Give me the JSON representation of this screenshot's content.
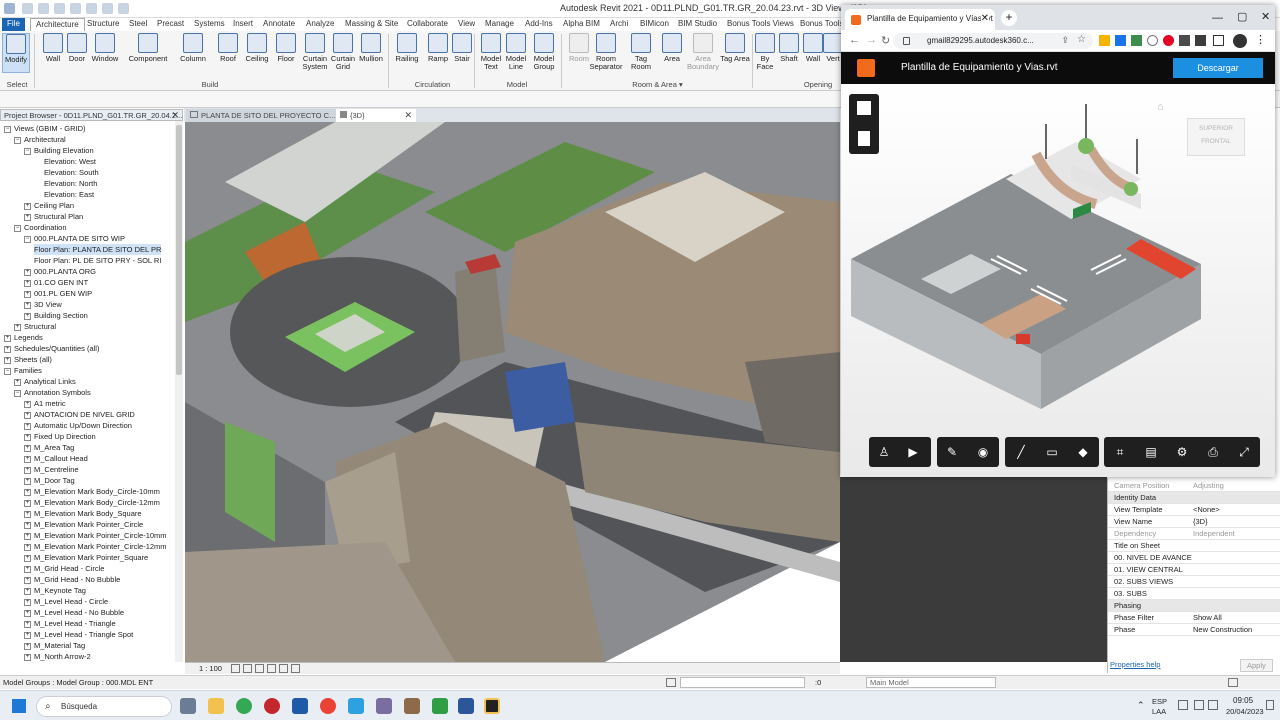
{
  "window": {
    "title": "Autodesk Revit 2021 - 0D11.PLND_G01.TR.GR_20.04.23.rvt - 3D View: {3D}"
  },
  "ribbon": {
    "tabs": [
      "File",
      "Architecture",
      "Structure",
      "Steel",
      "Precast",
      "Systems",
      "Insert",
      "Annotate",
      "Analyze",
      "Massing & Site",
      "Collaborate",
      "View",
      "Manage",
      "Add-Ins",
      "Alpha BIM",
      "Archi",
      "BIMicon",
      "BIM Studio",
      "Bonus Tools Views",
      "Bonus Tools"
    ],
    "buttons": [
      "Modify",
      "Wall",
      "Door",
      "Window",
      "Component",
      "Column",
      "Roof",
      "Ceiling",
      "Floor",
      "Curtain System",
      "Curtain Grid",
      "Mullion",
      "Railing",
      "Ramp",
      "Stair",
      "Model Text",
      "Model Line",
      "Model Group",
      "Room",
      "Room Separator",
      "Tag Room",
      "Area",
      "Area Boundary",
      "Tag Area",
      "By Face",
      "Shaft",
      "Wall",
      "Vert"
    ],
    "panels": {
      "select": "Select ▾",
      "build": "Build",
      "circulation": "Circulation",
      "model": "Model",
      "roomarea": "Room & Area ▾",
      "opening": "Opening"
    }
  },
  "browser": {
    "header": "Project Browser - 0D11.PLND_G01.TR.GR_20.04.2...",
    "items": [
      {
        "label": "Views (GBIM - GRID)",
        "indent": 0,
        "pm": "−"
      },
      {
        "label": "Architectural",
        "indent": 1,
        "pm": "−"
      },
      {
        "label": "Building Elevation",
        "indent": 2,
        "pm": "−"
      },
      {
        "label": "Elevation: West",
        "indent": 4,
        "pm": ""
      },
      {
        "label": "Elevation: South",
        "indent": 4,
        "pm": ""
      },
      {
        "label": "Elevation: North",
        "indent": 4,
        "pm": ""
      },
      {
        "label": "Elevation: East",
        "indent": 4,
        "pm": ""
      },
      {
        "label": "Ceiling Plan",
        "indent": 2,
        "pm": "+"
      },
      {
        "label": "Structural Plan",
        "indent": 2,
        "pm": "+"
      },
      {
        "label": "Coordination",
        "indent": 1,
        "pm": "−"
      },
      {
        "label": "000.PLANTA DE SITO WIP",
        "indent": 2,
        "pm": "−"
      },
      {
        "label": "Floor Plan: PLANTA DE SITO DEL PR",
        "indent": 3,
        "pm": "",
        "hl": true
      },
      {
        "label": "Floor Plan: PL DE SITO PRY - SOL RI",
        "indent": 3,
        "pm": ""
      },
      {
        "label": "000.PLANTA ORG",
        "indent": 2,
        "pm": "+"
      },
      {
        "label": "01.CO GEN INT",
        "indent": 2,
        "pm": "+"
      },
      {
        "label": "001.PL GEN WIP",
        "indent": 2,
        "pm": "+"
      },
      {
        "label": "3D View",
        "indent": 2,
        "pm": "+"
      },
      {
        "label": "Building Section",
        "indent": 2,
        "pm": "+"
      },
      {
        "label": "Structural",
        "indent": 1,
        "pm": "+"
      },
      {
        "label": "Legends",
        "indent": 0,
        "pm": "+"
      },
      {
        "label": "Schedules/Quantities (all)",
        "indent": 0,
        "pm": "+"
      },
      {
        "label": "Sheets (all)",
        "indent": 0,
        "pm": "+"
      },
      {
        "label": "Families",
        "indent": 0,
        "pm": "−"
      },
      {
        "label": "Analytical Links",
        "indent": 1,
        "pm": "+"
      },
      {
        "label": "Annotation Symbols",
        "indent": 1,
        "pm": "−"
      },
      {
        "label": "A1 metric",
        "indent": 2,
        "pm": "+"
      },
      {
        "label": "ANOTACION DE NIVEL GRID",
        "indent": 2,
        "pm": "+"
      },
      {
        "label": "Automatic Up/Down Direction",
        "indent": 2,
        "pm": "+"
      },
      {
        "label": "Fixed Up Direction",
        "indent": 2,
        "pm": "+"
      },
      {
        "label": "M_Area Tag",
        "indent": 2,
        "pm": "+"
      },
      {
        "label": "M_Callout Head",
        "indent": 2,
        "pm": "+"
      },
      {
        "label": "M_Centreline",
        "indent": 2,
        "pm": "+"
      },
      {
        "label": "M_Door Tag",
        "indent": 2,
        "pm": "+"
      },
      {
        "label": "M_Elevation Mark Body_Circle-10mm",
        "indent": 2,
        "pm": "+"
      },
      {
        "label": "M_Elevation Mark Body_Circle-12mm",
        "indent": 2,
        "pm": "+"
      },
      {
        "label": "M_Elevation Mark Body_Square",
        "indent": 2,
        "pm": "+"
      },
      {
        "label": "M_Elevation Mark Pointer_Circle",
        "indent": 2,
        "pm": "+"
      },
      {
        "label": "M_Elevation Mark Pointer_Circle-10mm",
        "indent": 2,
        "pm": "+"
      },
      {
        "label": "M_Elevation Mark Pointer_Circle-12mm",
        "indent": 2,
        "pm": "+"
      },
      {
        "label": "M_Elevation Mark Pointer_Square",
        "indent": 2,
        "pm": "+"
      },
      {
        "label": "M_Grid Head - Circle",
        "indent": 2,
        "pm": "+"
      },
      {
        "label": "M_Grid Head - No Bubble",
        "indent": 2,
        "pm": "+"
      },
      {
        "label": "M_Keynote Tag",
        "indent": 2,
        "pm": "+"
      },
      {
        "label": "M_Level Head - Circle",
        "indent": 2,
        "pm": "+"
      },
      {
        "label": "M_Level Head - No Bubble",
        "indent": 2,
        "pm": "+"
      },
      {
        "label": "M_Level Head - Triangle",
        "indent": 2,
        "pm": "+"
      },
      {
        "label": "M_Level Head - Triangle Spot",
        "indent": 2,
        "pm": "+"
      },
      {
        "label": "M_Material Tag",
        "indent": 2,
        "pm": "+"
      },
      {
        "label": "M_North Arrow-2",
        "indent": 2,
        "pm": "+"
      }
    ]
  },
  "viewtabs": [
    {
      "label": "PLANTA DE SITO DEL PROYECTO C..."
    },
    {
      "label": "{3D}"
    }
  ],
  "viewbar": {
    "scale": "1 : 100"
  },
  "properties": {
    "rows": [
      {
        "k": "Camera Position",
        "v": "Adjusting",
        "type": "dim"
      },
      {
        "k": "Identity Data",
        "v": "",
        "type": "grp"
      },
      {
        "k": "View Template",
        "v": "<None>",
        "type": ""
      },
      {
        "k": "View Name",
        "v": "{3D}",
        "type": ""
      },
      {
        "k": "Dependency",
        "v": "Independent",
        "type": "dim"
      },
      {
        "k": "Title on Sheet",
        "v": "",
        "type": ""
      },
      {
        "k": "00. NIVEL DE AVANCE",
        "v": "",
        "type": ""
      },
      {
        "k": "01. VIEW CENTRAL",
        "v": "",
        "type": ""
      },
      {
        "k": "02. SUBS VIEWS",
        "v": "",
        "type": ""
      },
      {
        "k": "03. SUBS",
        "v": "",
        "type": ""
      },
      {
        "k": "Phasing",
        "v": "",
        "type": "grp"
      },
      {
        "k": "Phase Filter",
        "v": "Show All",
        "type": ""
      },
      {
        "k": "Phase",
        "v": "New Construction",
        "type": ""
      }
    ],
    "help": "Properties help",
    "apply": "Apply"
  },
  "status": {
    "left": "Model Groups : Model Group : 000.MDL ENT",
    "zero": ":0",
    "model": "Main Model"
  },
  "taskbar": {
    "search": "Búsqueda",
    "lang": "ESP",
    "lang2": "LAA",
    "time": "09:05",
    "date": "20/04/2023"
  },
  "chrome": {
    "tab_title": "Plantilla de Equipamiento y Vías.rvt",
    "url": "gmail829295.autodesk360.c...",
    "doc_title": "Plantilla de Equipamiento y Vias.rvt",
    "download": "Descargar",
    "cube_top": "SUPERIOR",
    "cube_front": "FRONTAL"
  },
  "colors": {
    "accent": "#1a64b3",
    "download": "#1d8fe1",
    "fusion": "#f26b1d"
  }
}
